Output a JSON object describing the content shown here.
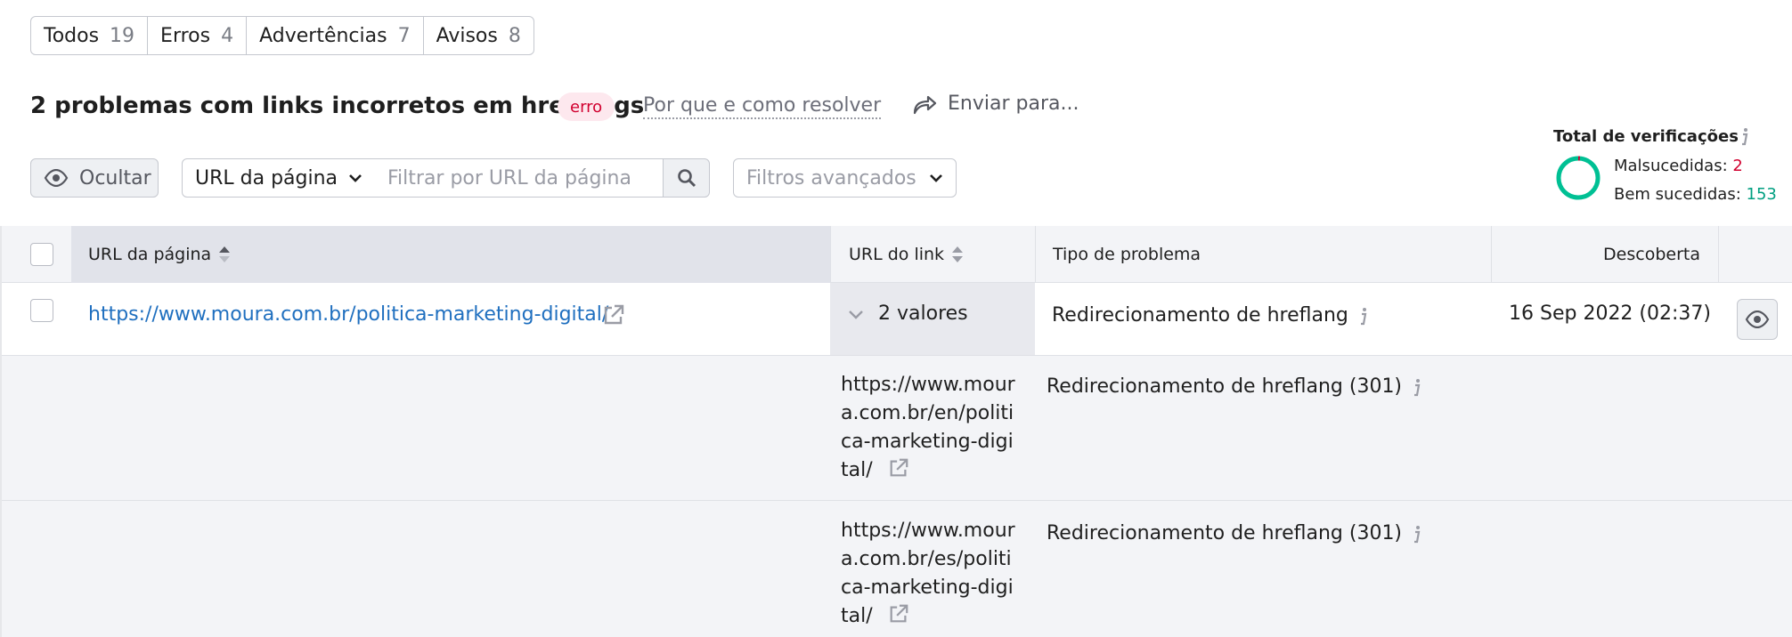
{
  "filters": [
    {
      "label": "Todos",
      "count": "19"
    },
    {
      "label": "Erros",
      "count": "4"
    },
    {
      "label": "Advertências",
      "count": "7"
    },
    {
      "label": "Avisos",
      "count": "8"
    }
  ],
  "header": {
    "title": "2 problemas com links incorretos em hreflangs",
    "badge": "erro",
    "why_link": "Por que e como resolver",
    "send": "Enviar para..."
  },
  "verifications": {
    "title": "Total de verificações",
    "failed_label": "Malsucedidas:",
    "failed_value": "2",
    "success_label": "Bem sucedidas:",
    "success_value": "153"
  },
  "toolbar": {
    "hide": "Ocultar",
    "url_select": "URL da página",
    "url_placeholder": "Filtrar por URL da página",
    "advanced": "Filtros avançados"
  },
  "table": {
    "headers": {
      "page_url": "URL da página",
      "link_url": "URL do link",
      "issue_type": "Tipo de problema",
      "discovered": "Descoberta"
    },
    "row": {
      "page_url": "https://www.moura.com.br/politica-marketing-digital/",
      "values": "2 valores",
      "issue": "Redirecionamento de hreflang",
      "date": "16 Sep 2022 (02:37)"
    },
    "subrows": [
      {
        "url_lines": [
          "https://www.mour",
          "a.com.br/en/politi",
          "ca-marketing-digi",
          "tal/"
        ],
        "issue": "Redirecionamento de hreflang (301)"
      },
      {
        "url_lines": [
          "https://www.mour",
          "a.com.br/es/politi",
          "ca-marketing-digi",
          "tal/"
        ],
        "issue": "Redirecionamento de hreflang (301)"
      }
    ]
  },
  "colors": {
    "link": "#1f6fbf",
    "error": "#d1002f",
    "success": "#009f81"
  }
}
